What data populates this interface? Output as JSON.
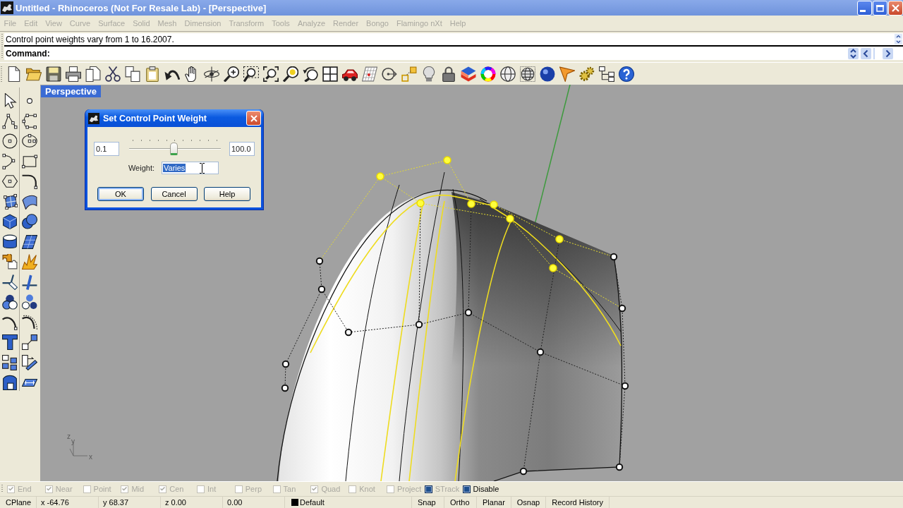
{
  "window": {
    "title": "Untitled - Rhinoceros (Not For Resale Lab) - [Perspective]"
  },
  "menu": [
    {
      "label": "File",
      "disabled": true
    },
    {
      "label": "Edit",
      "disabled": true
    },
    {
      "label": "View",
      "disabled": true
    },
    {
      "label": "Curve",
      "disabled": true
    },
    {
      "label": "Surface",
      "disabled": true
    },
    {
      "label": "Solid",
      "disabled": true
    },
    {
      "label": "Mesh",
      "disabled": true
    },
    {
      "label": "Dimension",
      "disabled": true
    },
    {
      "label": "Transform",
      "disabled": true
    },
    {
      "label": "Tools",
      "disabled": true
    },
    {
      "label": "Analyze",
      "disabled": true
    },
    {
      "label": "Render",
      "disabled": true
    },
    {
      "label": "Bongo",
      "disabled": true
    },
    {
      "label": "Flamingo nXt",
      "disabled": true
    },
    {
      "label": "Help",
      "disabled": true
    }
  ],
  "command_area": {
    "history": "Control point weights vary from 1 to 16.2007.",
    "prompt": "Command:"
  },
  "viewport": {
    "tab": "Perspective",
    "axis_labels": [
      "z",
      "y",
      "x"
    ],
    "control_points": [
      {
        "selected": false
      },
      {
        "selected": true
      },
      {
        "selected": true
      },
      {
        "selected": false
      },
      {
        "selected": true
      },
      {
        "selected": true
      },
      {
        "selected": true
      },
      {
        "selected": true
      },
      {
        "selected": true
      },
      {
        "selected": true
      },
      {
        "selected": false
      },
      {
        "selected": false
      },
      {
        "selected": false
      },
      {
        "selected": false
      },
      {
        "selected": false
      },
      {
        "selected": false
      },
      {
        "selected": false
      },
      {
        "selected": false
      },
      {
        "selected": false
      },
      {
        "selected": false
      },
      {
        "selected": false
      }
    ]
  },
  "dialog": {
    "title": "Set Control Point Weight",
    "min_value": "0.1",
    "max_value": "100.0",
    "slider": {
      "level": 0.49
    },
    "weight_label": "Weight:",
    "weight_field": {
      "value": "Varies",
      "selected": true
    },
    "buttons": [
      {
        "label": "OK",
        "default": true
      },
      {
        "label": "Cancel",
        "default": false
      },
      {
        "label": "Help",
        "default": false
      }
    ]
  },
  "osnap_bar": [
    {
      "label": "End",
      "kind": "osnap",
      "checked": true,
      "disabled": true
    },
    {
      "label": "Near",
      "kind": "osnap",
      "checked": true,
      "disabled": true
    },
    {
      "label": "Point",
      "kind": "osnap",
      "checked": false,
      "disabled": true
    },
    {
      "label": "Mid",
      "kind": "osnap",
      "checked": true,
      "disabled": true
    },
    {
      "label": "Cen",
      "kind": "osnap",
      "checked": true,
      "disabled": true
    },
    {
      "label": "Int",
      "kind": "osnap",
      "checked": false,
      "disabled": true
    },
    {
      "label": "Perp",
      "kind": "osnap",
      "checked": false,
      "disabled": true
    },
    {
      "label": "Tan",
      "kind": "osnap",
      "checked": false,
      "disabled": true
    },
    {
      "label": "Quad",
      "kind": "osnap",
      "checked": true,
      "disabled": true
    },
    {
      "label": "Knot",
      "kind": "osnap",
      "checked": false,
      "disabled": true
    },
    {
      "label": "Project",
      "kind": "toggle",
      "checked": false,
      "disabled": true
    },
    {
      "label": "STrack",
      "kind": "toggle",
      "checked": true,
      "disabled": true
    },
    {
      "label": "Disable",
      "kind": "toggle",
      "checked": true,
      "disabled": false
    }
  ],
  "status_bar": [
    {
      "kind": "label",
      "text": "CPlane"
    },
    {
      "kind": "coordinate",
      "text": "x -64.76"
    },
    {
      "kind": "coordinate",
      "text": "y 68.37"
    },
    {
      "kind": "coordinate",
      "text": "z 0.00"
    },
    {
      "kind": "coordinate",
      "text": "0.00"
    },
    {
      "kind": "layer",
      "text": "Default",
      "color": "#000000"
    },
    {
      "kind": "toggle",
      "text": "Snap"
    },
    {
      "kind": "toggle",
      "text": "Ortho"
    },
    {
      "kind": "toggle",
      "text": "Planar"
    },
    {
      "kind": "toggle",
      "text": "Osnap"
    },
    {
      "kind": "toggle",
      "text": "Record History"
    }
  ]
}
